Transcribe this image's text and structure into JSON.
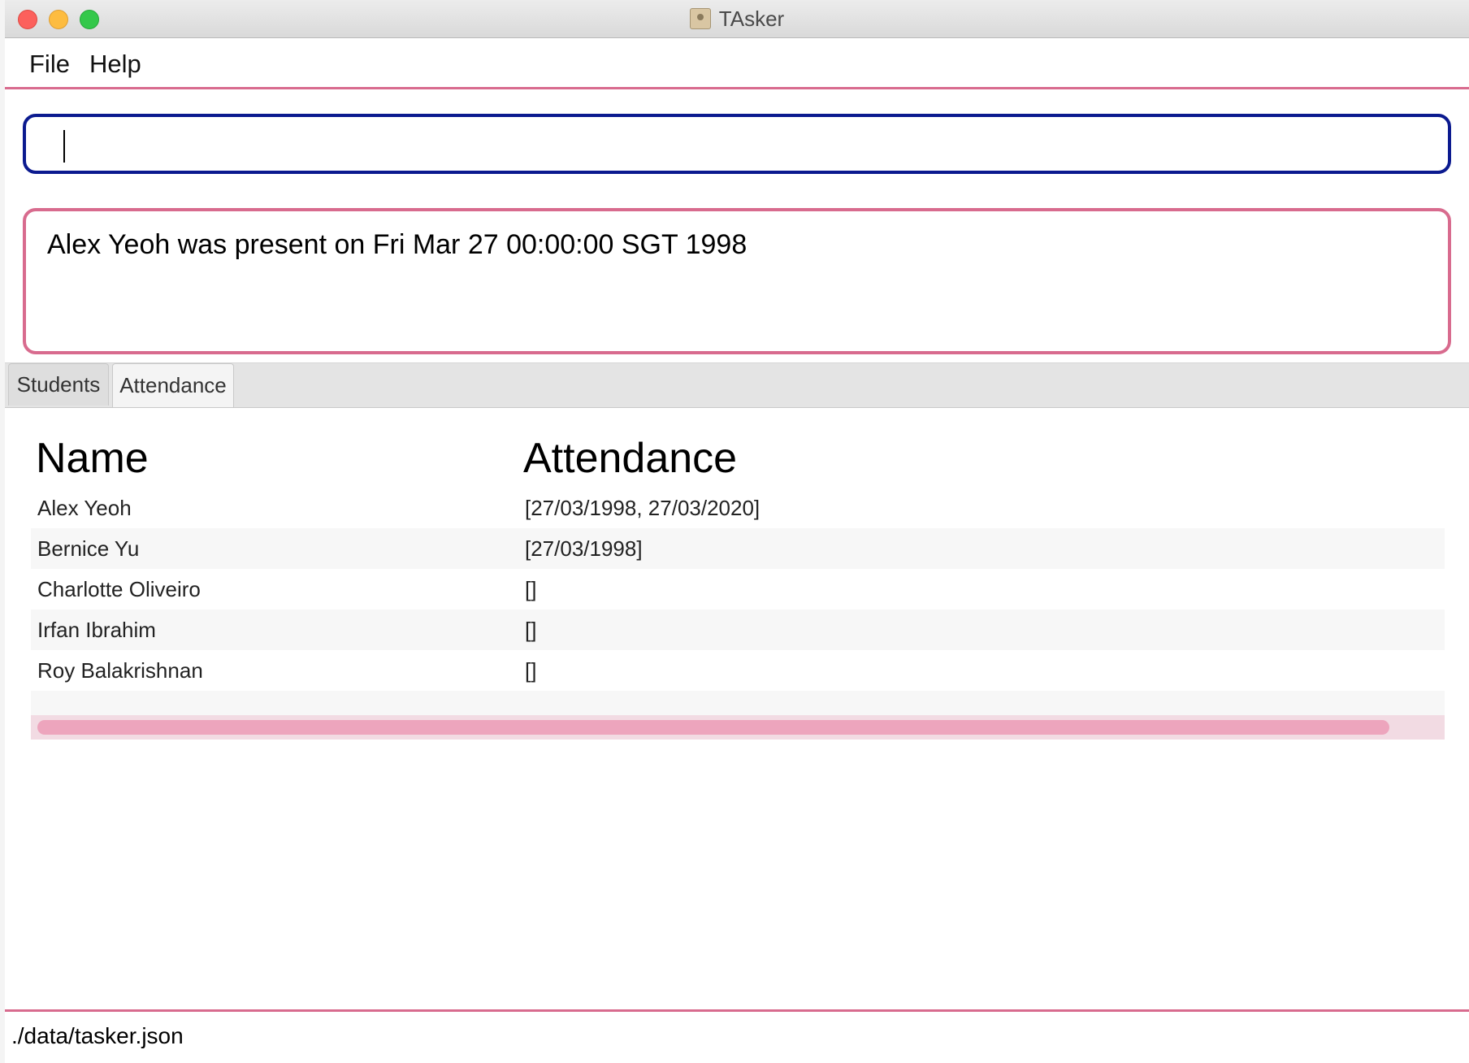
{
  "window": {
    "title": "TAsker"
  },
  "menu": {
    "file_label": "File",
    "help_label": "Help"
  },
  "command": {
    "value": ""
  },
  "result": {
    "message": "Alex Yeoh was present on Fri Mar 27 00:00:00 SGT 1998"
  },
  "tabs": [
    {
      "label": "Students",
      "selected": false
    },
    {
      "label": "Attendance",
      "selected": true
    }
  ],
  "attendance_table": {
    "headers": {
      "name": "Name",
      "attendance": "Attendance"
    },
    "rows": [
      {
        "name": "Alex Yeoh",
        "attendance": "[27/03/1998, 27/03/2020]"
      },
      {
        "name": "Bernice Yu",
        "attendance": "[27/03/1998]"
      },
      {
        "name": "Charlotte Oliveiro",
        "attendance": "[]"
      },
      {
        "name": "Irfan Ibrahim",
        "attendance": "[]"
      },
      {
        "name": "Roy Balakrishnan",
        "attendance": "[]"
      }
    ]
  },
  "status": {
    "file_path": "./data/tasker.json"
  },
  "colors": {
    "accent": "#d86b8e",
    "command_border": "#0b1a8f",
    "scroll_thumb": "#eda5bd"
  }
}
